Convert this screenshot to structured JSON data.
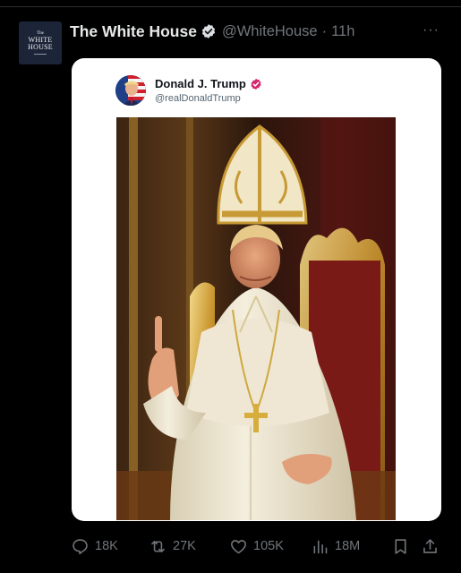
{
  "author": {
    "avatar_lines": [
      "The",
      "WHITE",
      "HOUSE"
    ],
    "display_name": "The White House",
    "verified_icon": "gold-verified-badge-icon",
    "handle": "@WhiteHouse",
    "separator": "·",
    "timestamp": "11h",
    "more": "···"
  },
  "quoted_post": {
    "display_name": "Donald J. Trump",
    "verified_icon": "verified-badge-icon",
    "handle": "@realDonaldTrump",
    "image": "photo of a man seated on an ornate golden throne dressed in white papal vestments and a tall gold mitre, raising one finger"
  },
  "actions": {
    "replies": "18K",
    "reposts": "27K",
    "likes": "105K",
    "views": "18M"
  },
  "colors": {
    "background": "#000000",
    "text": "#e7e9ea",
    "muted": "#71767b",
    "card": "#ffffff",
    "verified_gold": "#e2b719",
    "verified_pink": "#d6246e"
  }
}
